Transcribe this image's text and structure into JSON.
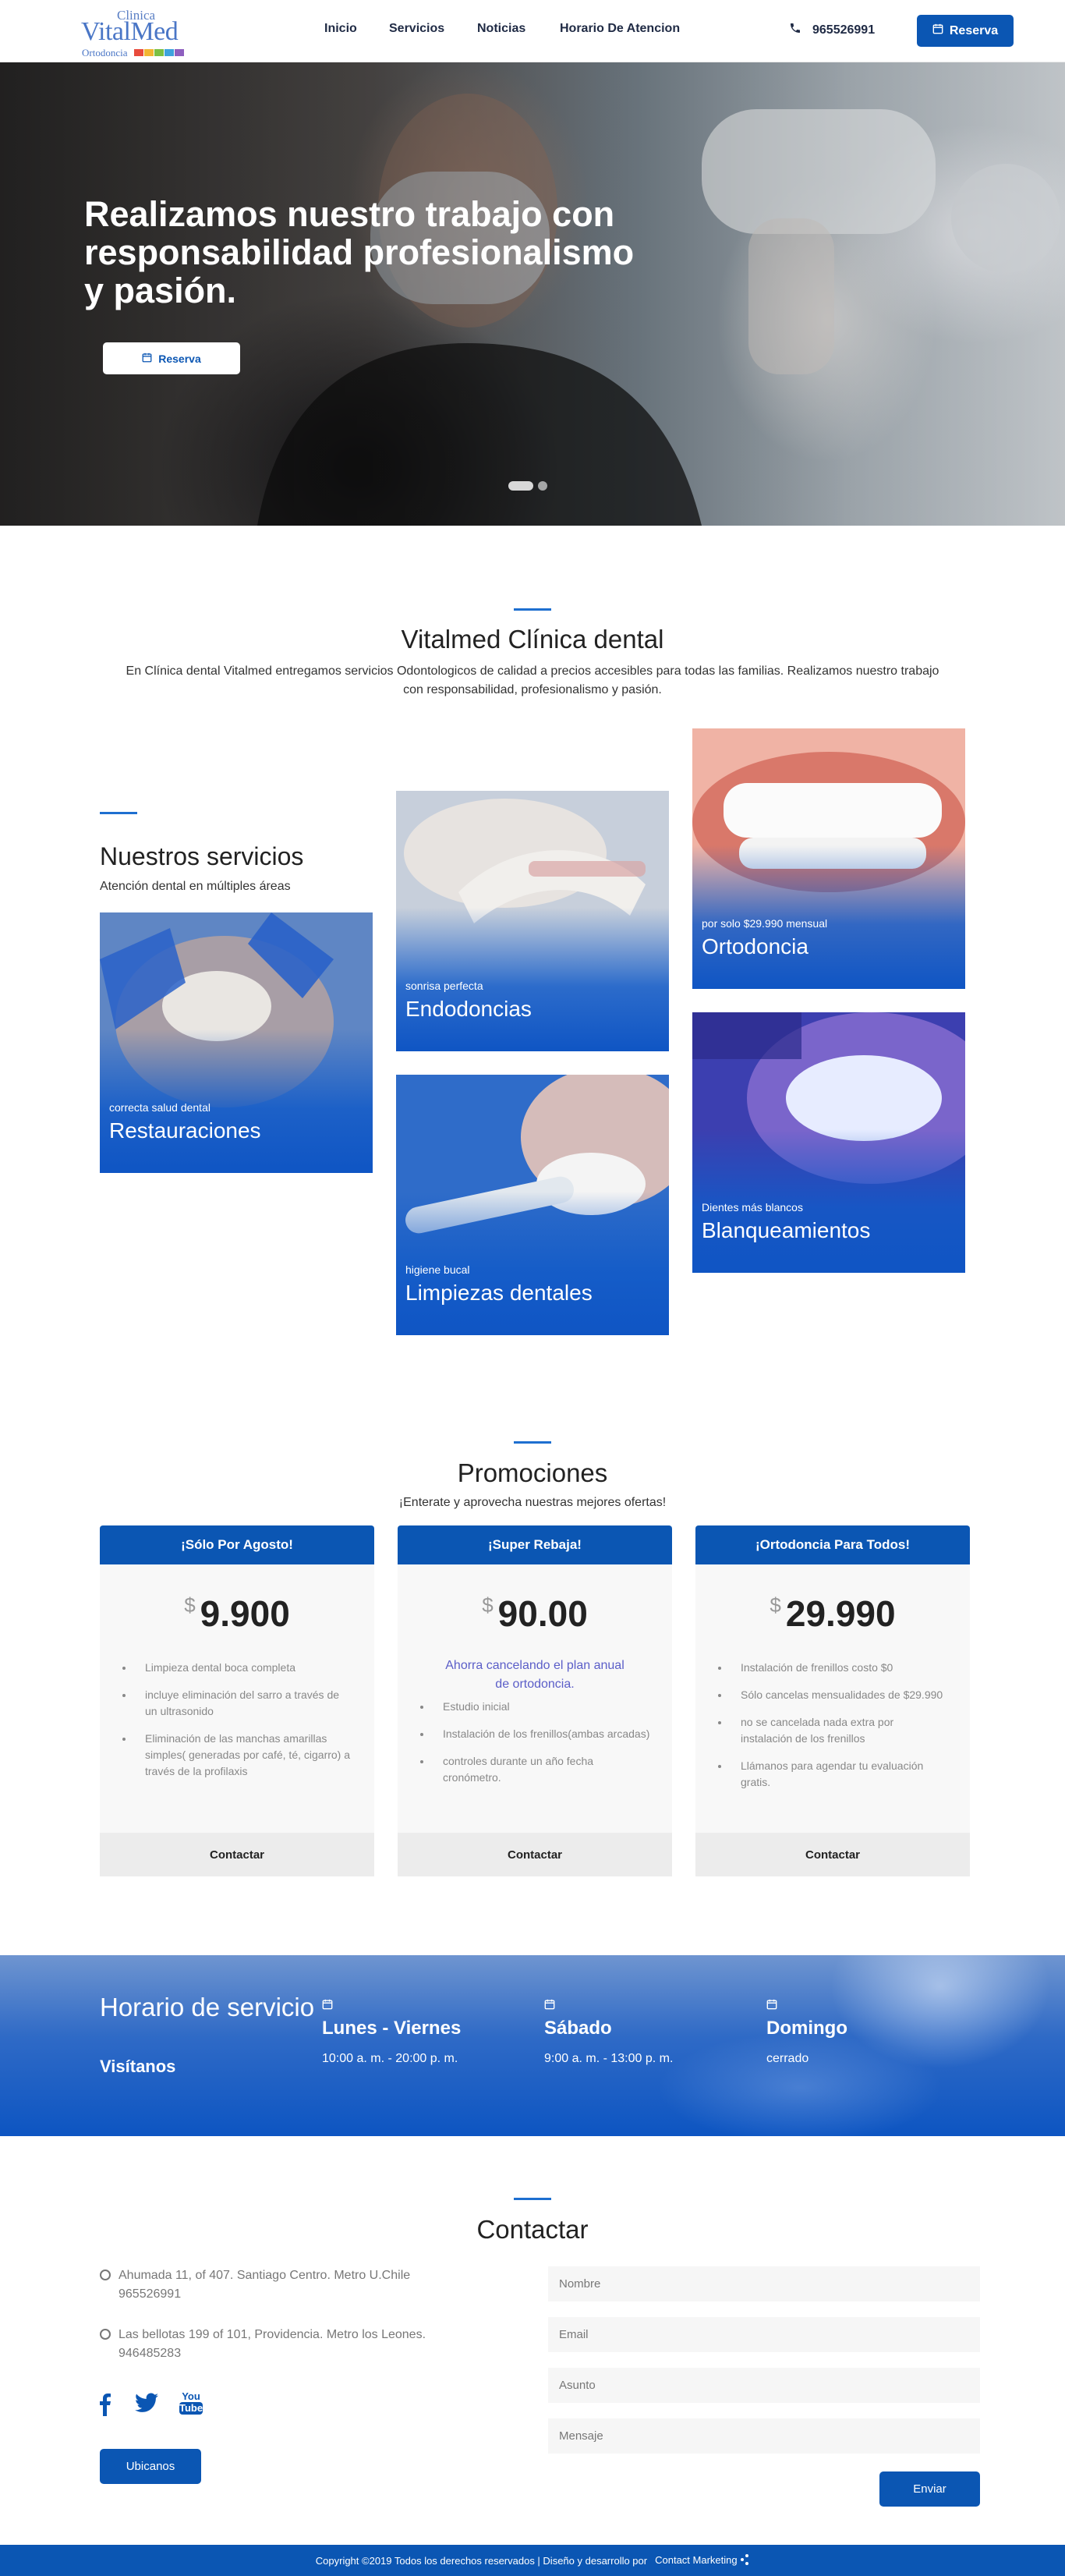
{
  "header": {
    "logo": {
      "top": "Clinica",
      "main": "VitalMed",
      "sub": "Ortodoncia",
      "bar_colors": [
        "#e84b3c",
        "#f2b632",
        "#7bc043",
        "#3da3de",
        "#8e5fbf"
      ]
    },
    "nav": [
      "Inicio",
      "Servicios",
      "Noticias",
      "Horario De Atencion"
    ],
    "phone": "965526991",
    "reserve_label": "Reserva"
  },
  "hero": {
    "title": "Realizamos nuestro trabajo con responsabilidad profesionalismo y pasión.",
    "button_label": "Reserva",
    "slides": 2,
    "active_slide": 1
  },
  "intro": {
    "title": "Vitalmed Clínica dental",
    "text": "En Clínica dental Vitalmed entregamos servicios Odontologicos de calidad a precios accesibles para todas las familias. Realizamos nuestro trabajo con responsabilidad, profesionalismo y pasión."
  },
  "services": {
    "title": "Nuestros servicios",
    "subtitle": "Atención dental en múltiples áreas",
    "cards": [
      {
        "small": "correcta salud dental",
        "big": "Restauraciones"
      },
      {
        "small": "sonrisa perfecta",
        "big": "Endodoncias"
      },
      {
        "small": "higiene bucal",
        "big": "Limpiezas dentales"
      },
      {
        "small": "por solo $29.990 mensual",
        "big": "Ortodoncia"
      },
      {
        "small": "Dientes más blancos",
        "big": "Blanqueamientos"
      }
    ]
  },
  "promotions": {
    "title": "Promociones",
    "subtitle": "¡Enterate y aprovecha nuestras mejores ofertas!",
    "items": [
      {
        "header": "¡Sólo Por Agosto!",
        "currency": "$",
        "price": "9.900",
        "note": "",
        "features": [
          "Limpieza dental boca completa",
          "incluye eliminación del sarro a través de un ultrasonido",
          "Eliminación de las manchas amarillas simples( generadas por café, té, cigarro) a través de la profilaxis"
        ],
        "cta": "Contactar"
      },
      {
        "header": "¡Super Rebaja!",
        "currency": "$",
        "price": "90.00",
        "note": "Ahorra cancelando el plan anual de ortodoncia.",
        "features": [
          "Estudio inicial",
          "Instalación de los frenillos(ambas arcadas)",
          "controles durante un año fecha cronómetro."
        ],
        "cta": "Contactar"
      },
      {
        "header": "¡Ortodoncia Para Todos!",
        "currency": "$",
        "price": "29.990",
        "note": "",
        "features": [
          "Instalación de frenillos costo $0",
          "Sólo cancelas mensualidades de $29.990",
          "no se cancelada nada extra por instalación de los frenillos",
          "Llámanos para agendar tu evaluación gratis."
        ],
        "cta": "Contactar"
      }
    ]
  },
  "schedule": {
    "title": "Horario de servicio",
    "subtitle": "Visítanos",
    "days": [
      {
        "name": "Lunes - Viernes",
        "hours": "10:00 a. m. - 20:00 p. m."
      },
      {
        "name": "Sábado",
        "hours": "9:00 a. m. - 13:00 p. m."
      },
      {
        "name": "Domingo",
        "hours": "cerrado"
      }
    ]
  },
  "contact": {
    "title": "Contactar",
    "addresses": [
      {
        "line1": "Ahumada 11, of 407. Santiago Centro. Metro U.Chile",
        "line2": "965526991"
      },
      {
        "line1": "Las bellotas 199 of 101, Providencia. Metro los Leones.",
        "line2": "946485283"
      }
    ],
    "social": [
      "facebook",
      "twitter",
      "youtube"
    ],
    "youtube_label_top": "You",
    "youtube_label_bottom": "Tube",
    "map_button": "Ubicanos",
    "form": {
      "name_placeholder": "Nombre",
      "email_placeholder": "Email",
      "subject_placeholder": "Asunto",
      "message_placeholder": "Mensaje",
      "submit_label": "Enviar"
    }
  },
  "footer": {
    "text": "Copyright ©2019 Todos los derechos reservados | Diseño y desarrollo por",
    "brand": "Contact Marketing"
  },
  "colors": {
    "primary": "#0b56b3",
    "accent_rule": "#1e6fd0",
    "promo_note": "#5b5ec8"
  }
}
